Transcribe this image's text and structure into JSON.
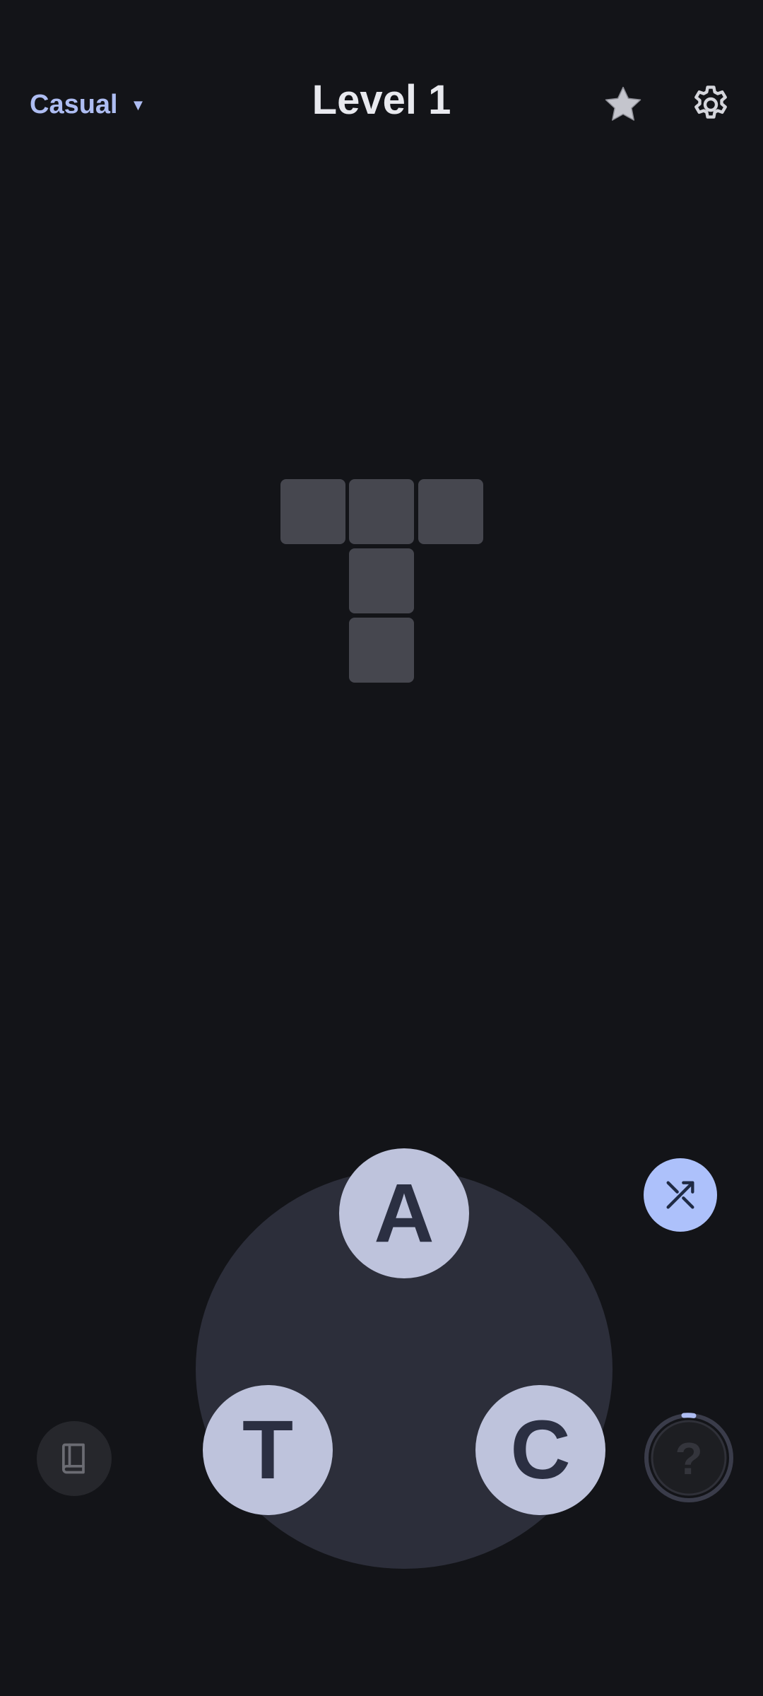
{
  "header": {
    "mode_label": "Casual",
    "mode_caret": "▼",
    "level_title": "Level 1",
    "favorite_icon": "star-icon",
    "settings_icon": "gear-icon"
  },
  "grid": {
    "shape": "T-shaped crossword, 3 across on top row, 2 more cells below the middle",
    "cell_color": "#46474f"
  },
  "wheel": {
    "letters": [
      "A",
      "T",
      "C"
    ],
    "letter_color": "#2b2f42",
    "tile_color": "#bec3dc",
    "wheel_color": "#2c2e3a"
  },
  "controls": {
    "shuffle_icon": "shuffle-icon",
    "dictionary_icon": "book-icon",
    "hint_icon": "question-mark-icon",
    "hint_glyph": "?"
  },
  "colors": {
    "background": "#131418",
    "accent": "#aebdf2",
    "shuffle_bg": "#adc1fb"
  }
}
